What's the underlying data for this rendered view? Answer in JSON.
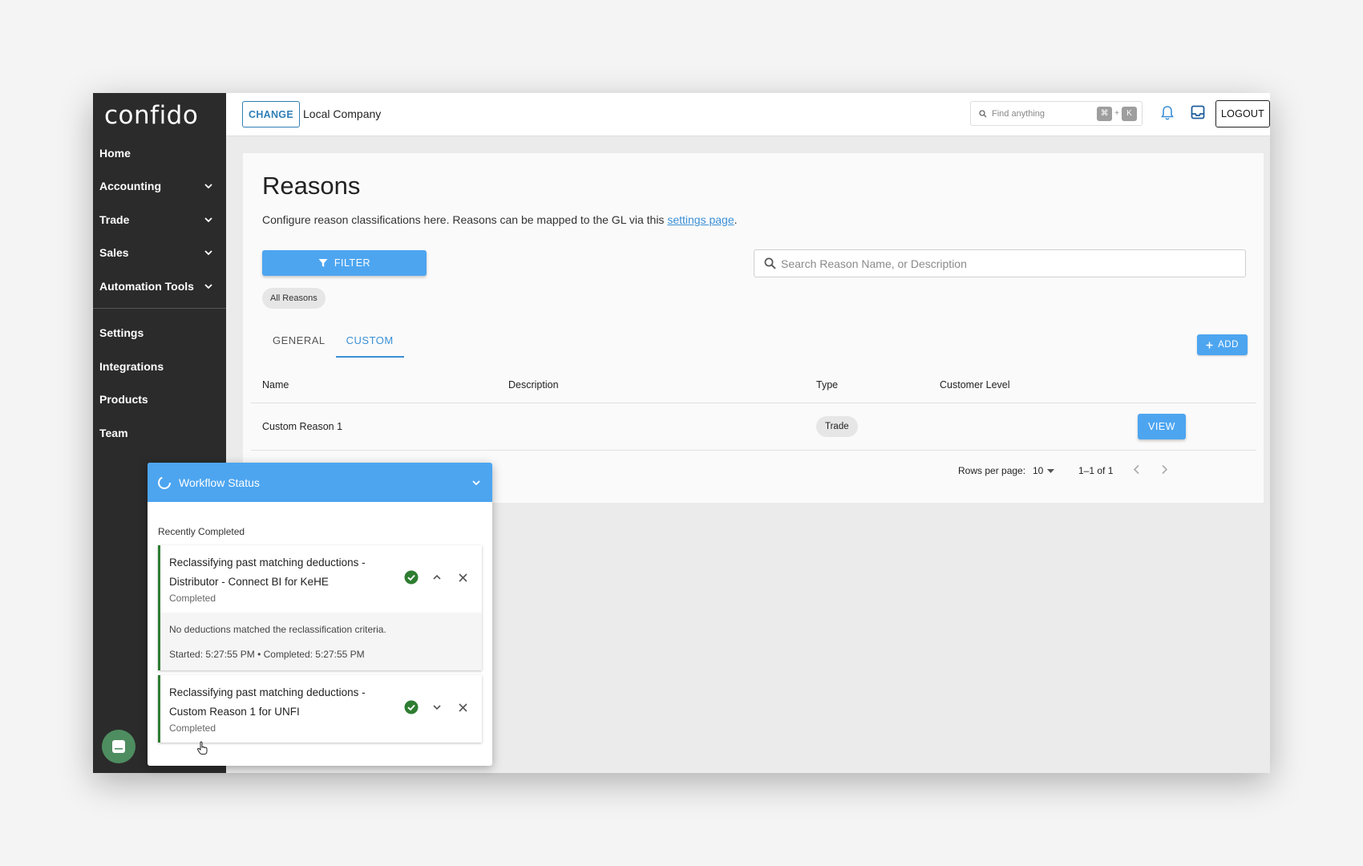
{
  "app": {
    "logo": "confido"
  },
  "sidebar": {
    "items": [
      {
        "label": "Home",
        "expandable": false
      },
      {
        "label": "Accounting",
        "expandable": true
      },
      {
        "label": "Trade",
        "expandable": true
      },
      {
        "label": "Sales",
        "expandable": true
      },
      {
        "label": "Automation Tools",
        "expandable": true
      }
    ],
    "items2": [
      {
        "label": "Settings"
      },
      {
        "label": "Integrations"
      },
      {
        "label": "Products"
      },
      {
        "label": "Team"
      }
    ]
  },
  "topbar": {
    "change_label": "CHANGE",
    "company": "Local Company",
    "find_placeholder": "Find anything",
    "kbd1": "⌘",
    "kbd_plus": "+",
    "kbd2": "K",
    "logout_label": "LOGOUT"
  },
  "page": {
    "title": "Reasons",
    "subtitle_prefix": "Configure reason classifications here. Reasons can be mapped to the GL via this ",
    "subtitle_link": "settings page",
    "subtitle_suffix": ".",
    "filter_label": "FILTER",
    "search_placeholder": "Search Reason Name, or Description",
    "chip_label": "All Reasons",
    "tabs": [
      {
        "label": "GENERAL",
        "active": false
      },
      {
        "label": "CUSTOM",
        "active": true
      }
    ],
    "add_label": "ADD"
  },
  "table": {
    "headers": {
      "name": "Name",
      "description": "Description",
      "type": "Type",
      "customer_level": "Customer Level"
    },
    "rows": [
      {
        "name": "Custom Reason 1",
        "description": "",
        "type": "Trade",
        "customer_level": "",
        "action": "VIEW"
      }
    ],
    "pagination": {
      "rows_label": "Rows per page:",
      "rows_value": "10",
      "range": "1–1 of 1"
    }
  },
  "workflow": {
    "title": "Workflow Status",
    "section": "Recently Completed",
    "jobs": [
      {
        "title": "Reclassifying past matching deductions - Distributor - Connect BI for KeHE",
        "status": "Completed",
        "expanded": true,
        "message": "No deductions matched the reclassification criteria.",
        "times": "Started: 5:27:55 PM • Completed: 5:27:55 PM"
      },
      {
        "title": "Reclassifying past matching deductions - Custom Reason 1 for UNFI",
        "status": "Completed",
        "expanded": false
      }
    ]
  },
  "colors": {
    "accent": "#4da5f0",
    "sidebar": "#2b2b2b",
    "success": "#2e7d32",
    "link": "#3a8fd6"
  }
}
